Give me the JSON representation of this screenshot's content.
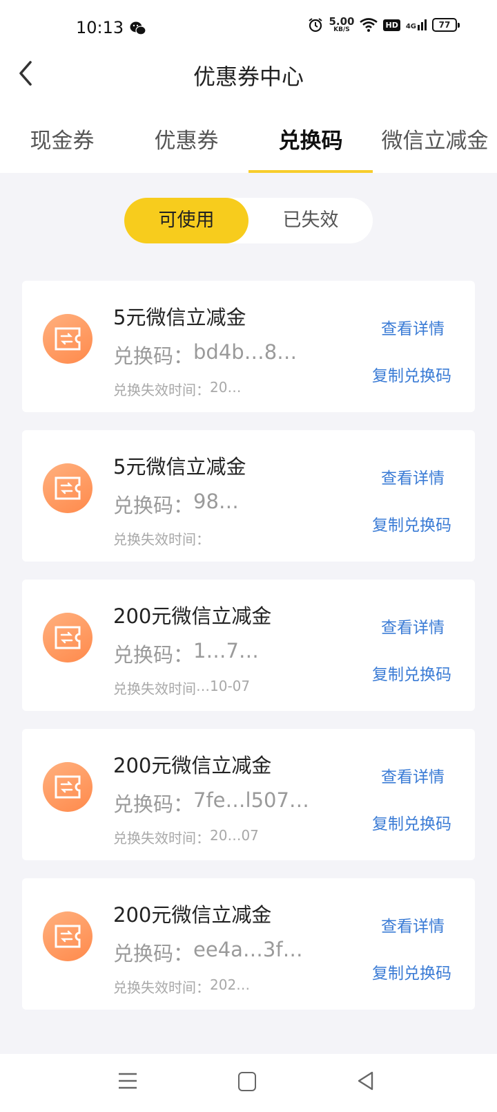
{
  "status_bar": {
    "time": "10:13",
    "speed_value": "5.00",
    "speed_unit": "KB/S",
    "hd_label": "HD",
    "network_label": "4G",
    "battery": "77"
  },
  "header": {
    "title": "优惠券中心"
  },
  "tabs": [
    {
      "label": "现金券",
      "active": false
    },
    {
      "label": "优惠券",
      "active": false
    },
    {
      "label": "兑换码",
      "active": true
    },
    {
      "label": "微信立减金",
      "active": false
    }
  ],
  "segment": {
    "available": "可使用",
    "expired": "已失效"
  },
  "cards": [
    {
      "title": "5元微信立减金",
      "code_label": "兑换码：",
      "code": "bd4b…8…",
      "expire_label": "兑换失效时间：",
      "expire": "20…",
      "detail_label": "查看详情",
      "copy_label": "复制兑换码"
    },
    {
      "title": "5元微信立减金",
      "code_label": "兑换码：",
      "code": "98…",
      "expire_label": "兑换失效时间：",
      "expire": "",
      "detail_label": "查看详情",
      "copy_label": "复制兑换码"
    },
    {
      "title": "200元微信立减金",
      "code_label": "兑换码：",
      "code": "1…7…",
      "expire_label": "兑换失效时间",
      "expire": "…10-07",
      "detail_label": "查看详情",
      "copy_label": "复制兑换码"
    },
    {
      "title": "200元微信立减金",
      "code_label": "兑换码：",
      "code": "7fe…l507…",
      "expire_label": "兑换失效时间：",
      "expire": "20…07",
      "detail_label": "查看详情",
      "copy_label": "复制兑换码"
    },
    {
      "title": "200元微信立减金",
      "code_label": "兑换码：",
      "code": "ee4a…3f…",
      "expire_label": "兑换失效时间：",
      "expire": "202…",
      "detail_label": "查看详情",
      "copy_label": "复制兑换码"
    }
  ],
  "icons": {
    "back": "chevron-left-icon",
    "coupon": "ticket-exchange-icon",
    "nav_menu": "menu-icon",
    "nav_home": "square-home-icon",
    "nav_back": "triangle-back-icon"
  },
  "colors": {
    "accent_yellow": "#f7cc1d",
    "link_blue": "#3a7bd5",
    "icon_orange": "#ff9a5c"
  }
}
